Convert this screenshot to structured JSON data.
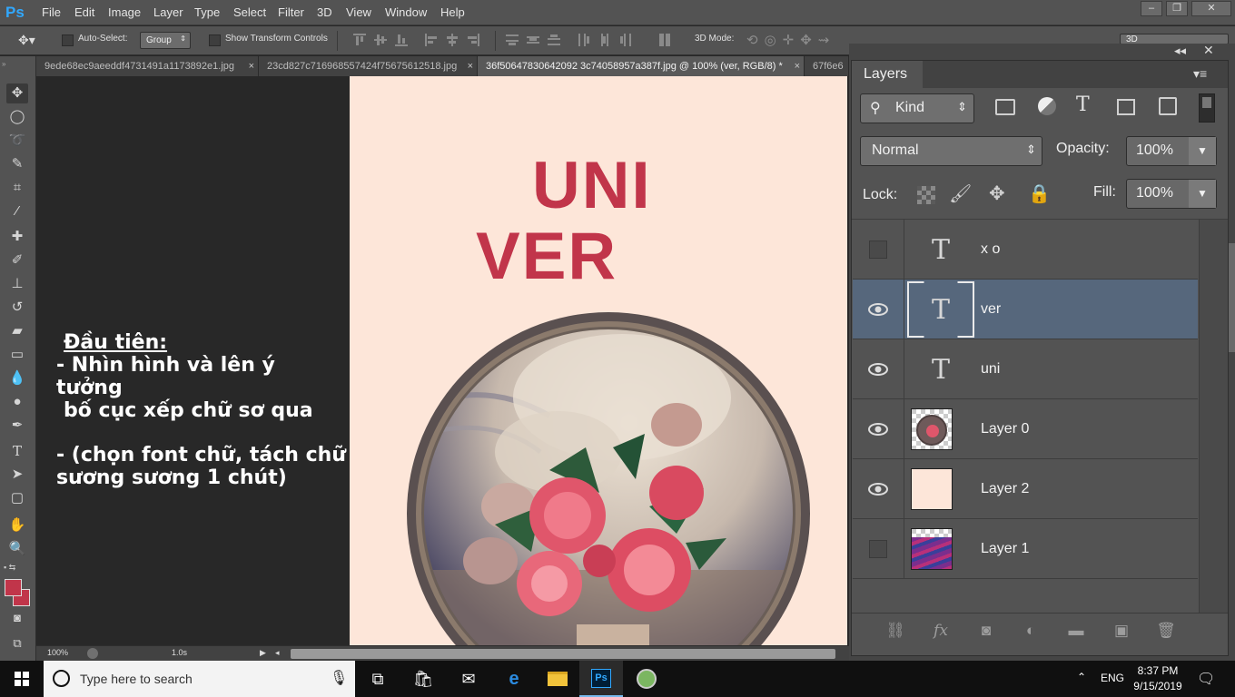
{
  "menubar": {
    "logo": "Ps",
    "items": [
      "File",
      "Edit",
      "Image",
      "Layer",
      "Type",
      "Select",
      "Filter",
      "3D",
      "View",
      "Window",
      "Help"
    ],
    "window_buttons": [
      "minimize",
      "restore",
      "close"
    ]
  },
  "options_bar": {
    "auto_select_label": "Auto-Select:",
    "auto_select_checked": false,
    "group_value": "Group",
    "show_transform_label": "Show Transform Controls",
    "show_transform_checked": false,
    "mode_3d_label": "3D Mode:",
    "workspace_value": "3D"
  },
  "tabs": [
    {
      "label": "9ede68ec9aeeddf4731491a1173892e1.jpg",
      "active": false
    },
    {
      "label": "23cd827c716968557424f75675612518.jpg",
      "active": false
    },
    {
      "label": "36f50647830642092 3c74058957a387f.jpg @ 100% (ver, RGB/8) *",
      "active": true
    },
    {
      "label": "67f6e6",
      "active": false
    }
  ],
  "tab_close_glyph": "×",
  "annotation": {
    "heading": "Đầu tiên:",
    "line1": "- Nhìn hình và lên ý tưởng",
    "line2": "bố cục xếp chữ sơ qua",
    "line3": "- (chọn font chữ, tách chữ",
    "line4": "sương sương 1 chút)"
  },
  "document": {
    "text_uni": "UNI",
    "text_ver": "VER",
    "background_color": "#fde6d9",
    "text_color": "#c1354a"
  },
  "statusbar": {
    "zoom": "100%",
    "timing": "1.0s"
  },
  "layers_panel": {
    "title": "Layers",
    "filter_kind": "Kind",
    "blend_mode": "Normal",
    "opacity_label": "Opacity:",
    "opacity_value": "100%",
    "lock_label": "Lock:",
    "fill_label": "Fill:",
    "fill_value": "100%",
    "layers": [
      {
        "name": "x o",
        "type": "text",
        "visible": false,
        "selected": false
      },
      {
        "name": "ver",
        "type": "text",
        "visible": true,
        "selected": true
      },
      {
        "name": "uni",
        "type": "text",
        "visible": true,
        "selected": false
      },
      {
        "name": "Layer 0",
        "type": "image",
        "visible": true,
        "selected": false
      },
      {
        "name": "Layer 2",
        "type": "fill",
        "visible": true,
        "selected": false
      },
      {
        "name": "Layer 1",
        "type": "image",
        "visible": false,
        "selected": false
      }
    ],
    "footer_icons": [
      "link-icon",
      "fx-icon",
      "mask-icon",
      "adjustment-icon",
      "folder-icon",
      "new-layer-icon",
      "trash-icon"
    ]
  },
  "taskbar": {
    "search_placeholder": "Type here to search",
    "language": "ENG",
    "time": "8:37 PM",
    "date": "9/15/2019"
  },
  "colors": {
    "accent_selected": "#56677c",
    "foreground_swatch": "#c1354a",
    "ps_blue": "#31a8ff"
  }
}
